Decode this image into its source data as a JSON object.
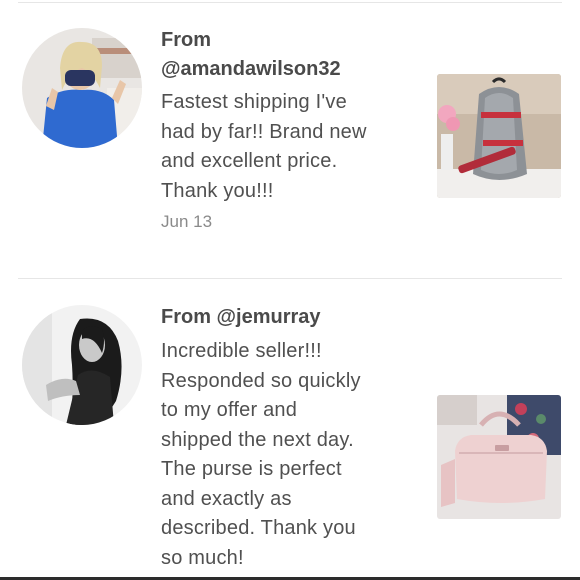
{
  "reviews": [
    {
      "from_label": "From",
      "username": "@amandawilson32",
      "text": "Fastest shipping I've had by far!! Brand new and excellent price. Thank you!!!",
      "lines": [
        "Fastest shipping I've",
        "had by far!! Brand new",
        "and excellent price.",
        "Thank you!!!"
      ],
      "date": "Jun 13",
      "product_image": "gray-michael-kors-sling-backpack"
    },
    {
      "from_line": "From @jemurray",
      "lines": [
        "Incredible seller!!!",
        "Responded so quickly",
        "to my offer and",
        "shipped the next day.",
        "The purse is perfect",
        "and exactly as",
        "described. Thank you",
        "so much!"
      ],
      "product_image": "pink-satchel-handbag"
    }
  ]
}
